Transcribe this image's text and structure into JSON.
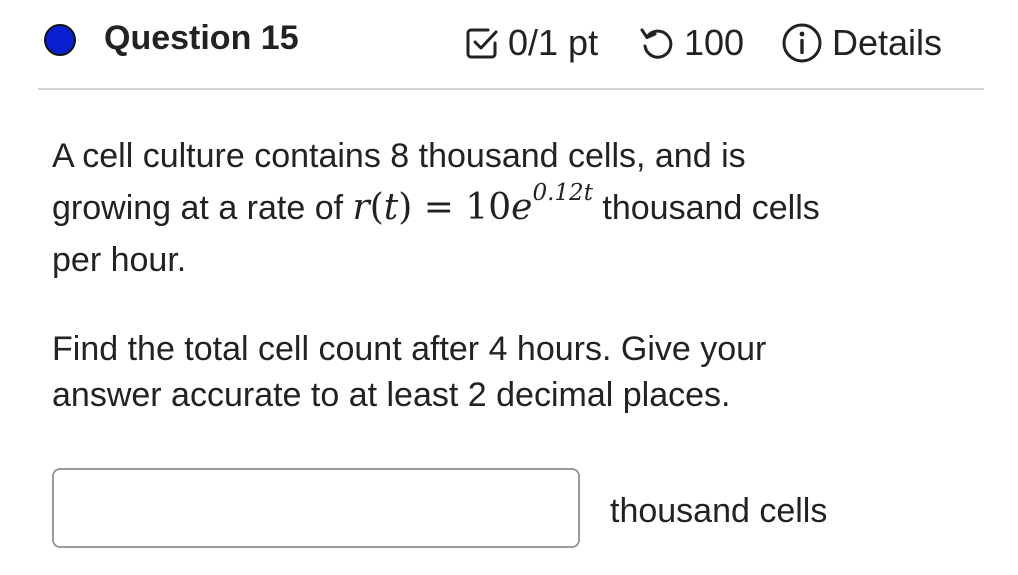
{
  "header": {
    "title": "Question 15",
    "score": "0/1 pt",
    "attempts": "100",
    "details_label": "Details"
  },
  "question": {
    "line1": "A cell culture contains 8 thousand cells, and is",
    "line2_prefix": "growing at a rate of ",
    "math": {
      "r": "r",
      "open": "(",
      "t": "t",
      "close": ")",
      "equals": " = ",
      "coef": "10",
      "base": "e",
      "exponent": "0.12t"
    },
    "line2_suffix": " thousand cells",
    "line3": "per hour.",
    "instruction_line1": "Find the total cell count after 4 hours. Give your",
    "instruction_line2": "answer accurate to at least 2 decimal places."
  },
  "answer": {
    "value": "",
    "units": "thousand cells"
  },
  "colors": {
    "status_dot": "#0a1fd0",
    "text": "#222222",
    "divider": "#d6d6d6",
    "input_border": "#9a9a9a"
  },
  "icons": {
    "status": "status-dot-icon",
    "score": "checkbox-check-icon",
    "attempts": "retry-icon",
    "details": "info-icon"
  }
}
